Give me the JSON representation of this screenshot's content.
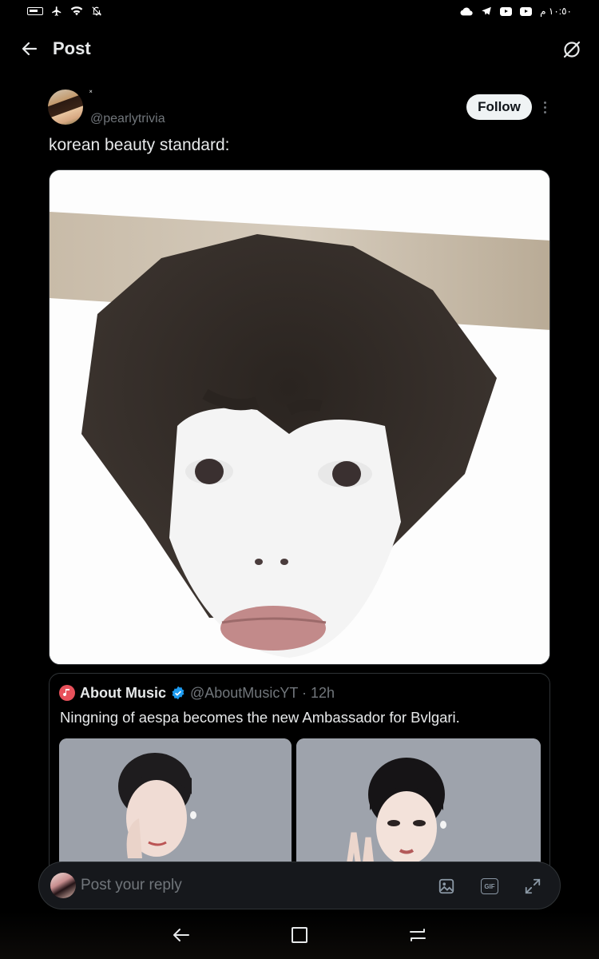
{
  "status_bar": {
    "time": "١٠:٥٠ م"
  },
  "header": {
    "title": "Post"
  },
  "post": {
    "display_name": "˟",
    "handle": "@pearlytrivia",
    "follow_label": "Follow",
    "text": "korean beauty standard:"
  },
  "quote": {
    "name": "About Music",
    "handle_time": "@AboutMusicYT · 12h",
    "text": "Ningning of aespa becomes the new Ambassador for Bvlgari."
  },
  "reply": {
    "placeholder": "Post your reply",
    "gif_label": "GIF"
  },
  "colors": {
    "background": "#000000",
    "text": "#e7e9ea",
    "muted": "#71767b",
    "verified": "#1d9bf0",
    "follow_bg": "#eff3f4"
  }
}
